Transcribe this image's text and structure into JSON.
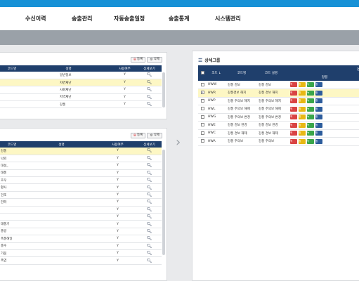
{
  "nav": {
    "items": [
      "수신이력",
      "송출관리",
      "자동송출일정",
      "송출통계",
      "시스템관리"
    ]
  },
  "top_panel": {
    "buttons": {
      "register": "등록",
      "delete": "삭제"
    },
    "columns": [
      "코드명",
      "설명",
      "사용여부",
      "상세보기"
    ],
    "rows": [
      {
        "code": "",
        "desc": "일반정보",
        "use": "Y"
      },
      {
        "code": "",
        "desc": "자연재난",
        "use": "Y"
      },
      {
        "code": "",
        "desc": "사회재난",
        "use": "Y"
      },
      {
        "code": "",
        "desc": "지역재난",
        "use": "Y"
      },
      {
        "code": "",
        "desc": "강풍",
        "use": "Y"
      }
    ],
    "selected_row": 1
  },
  "bottom_panel": {
    "buttons": {
      "register": "등록",
      "delete": "삭제"
    },
    "columns": [
      "코드명",
      "설명",
      "사용여부",
      "상세보기"
    ],
    "rows": [
      {
        "code": "강풍",
        "use": "Y"
      },
      {
        "code": "낙뢰",
        "use": "Y"
      },
      {
        "code": "대설_",
        "use": "Y"
      },
      {
        "code": "태풍",
        "use": "Y"
      },
      {
        "code": "호우",
        "use": "Y"
      },
      {
        "code": "황사",
        "use": "Y"
      },
      {
        "code": "건조",
        "use": "Y"
      },
      {
        "code": "한파",
        "use": "Y"
      },
      {
        "code": "",
        "use": "Y"
      },
      {
        "code": "",
        "use": "Y"
      },
      {
        "code": "태풍기",
        "use": "Y"
      },
      {
        "code": "풍랑",
        "use": "Y"
      },
      {
        "code": "폭풍해일",
        "use": "Y"
      },
      {
        "code": "홍수",
        "use": "Y"
      },
      {
        "code": "가뭄",
        "use": "Y"
      },
      {
        "code": "폭염",
        "use": "Y"
      }
    ],
    "selected_row": 0
  },
  "right_panel": {
    "title": "상세그룹",
    "columns": [
      "코드 ↓",
      "코드명",
      "코드 설명",
      "경보"
    ],
    "sub_header": "정렬",
    "action_tags": [
      "적",
      "합",
      "녹",
      "청"
    ],
    "rows": [
      {
        "code": "HWW",
        "name": "강풍 경보",
        "desc": "강풍 경보",
        "checked": false
      },
      {
        "code": "HWR",
        "name": "강풍경보 해지",
        "desc": "강풍 경보 해지",
        "checked": true
      },
      {
        "code": "HWP",
        "name": "강풍 주의보 해지",
        "desc": "강풍 주의보 해지",
        "checked": false
      },
      {
        "code": "HWL",
        "name": "강풍 주의보 해제",
        "desc": "강풍 주의보 해제",
        "checked": false
      },
      {
        "code": "HWG",
        "name": "강풍 주의보 변경",
        "desc": "강풍 주의보 변경",
        "checked": false
      },
      {
        "code": "HWE",
        "name": "강풍 경보 변경",
        "desc": "강풍 경보 변경",
        "checked": false
      },
      {
        "code": "HWC",
        "name": "강풍 경보 해제",
        "desc": "강풍 경보 해제",
        "checked": false
      },
      {
        "code": "HWA",
        "name": "강풍 주의보",
        "desc": "강풍 주의보",
        "checked": false
      }
    ],
    "selected_row": 1
  },
  "colors": {
    "topbar": "#1791d6",
    "header": "#1f3f6c",
    "selected_row": "#fdf7c4",
    "tag_red": "#d94343",
    "tag_yellow": "#e8b814",
    "tag_green": "#3aa54a",
    "tag_blue": "#2c5c9c"
  },
  "icons": [
    "plus-circle-icon",
    "gear-icon",
    "magnifier-icon",
    "hamburger-icon",
    "chevron-right-icon"
  ]
}
